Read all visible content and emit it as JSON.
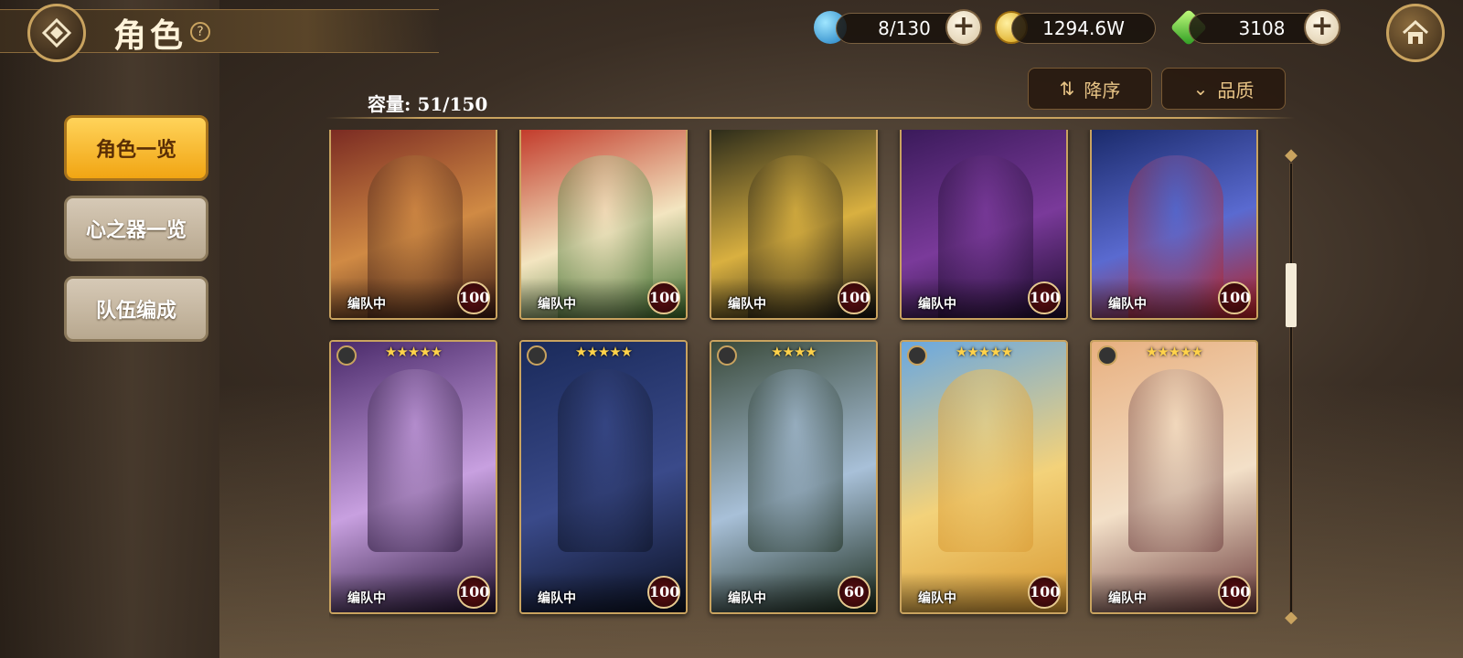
{
  "header": {
    "title": "角色",
    "help": "?",
    "back_icon": "diamond-back-icon",
    "home_icon": "home-icon"
  },
  "resources": {
    "stamina": {
      "value": "8/130",
      "icon": "water-drop-icon"
    },
    "gold": {
      "value": "1294.6W",
      "icon": "gold-coin-icon"
    },
    "gems": {
      "value": "3108",
      "icon": "green-crystal-icon"
    },
    "plus_label": "+"
  },
  "menu": {
    "items": [
      {
        "label": "角色一览",
        "active": true
      },
      {
        "label": "心之器一览",
        "active": false
      },
      {
        "label": "队伍编成",
        "active": false
      }
    ]
  },
  "toolbar": {
    "capacity": "容量: 51/150",
    "sort_label": "降序",
    "filter_label": "品质"
  },
  "cards": [
    {
      "team": "编队中",
      "level": "100",
      "stars": "",
      "colors": [
        "#7a2a22",
        "#d08a44",
        "#3a1a14"
      ]
    },
    {
      "team": "编队中",
      "level": "100",
      "stars": "",
      "colors": [
        "#c23a2a",
        "#f3e5c0",
        "#3b6b2a"
      ]
    },
    {
      "team": "编队中",
      "level": "100",
      "stars": "",
      "colors": [
        "#2a2a1a",
        "#d9b040",
        "#101010"
      ]
    },
    {
      "team": "编队中",
      "level": "100",
      "stars": "",
      "colors": [
        "#3a1a5a",
        "#7a3a9a",
        "#1a0a2a"
      ]
    },
    {
      "team": "编队中",
      "level": "100",
      "stars": "",
      "colors": [
        "#1a2a6a",
        "#5a6ad0",
        "#b82020"
      ]
    },
    {
      "team": "编队中",
      "level": "100",
      "stars": "★★★★★",
      "colors": [
        "#4a2a6a",
        "#c8a0e0",
        "#201030"
      ]
    },
    {
      "team": "编队中",
      "level": "100",
      "stars": "★★★★★",
      "colors": [
        "#1a2a5a",
        "#3a4a8a",
        "#0a1020"
      ]
    },
    {
      "team": "编队中",
      "level": "60",
      "stars": "★★★★",
      "colors": [
        "#3a4a3a",
        "#a8c0d8",
        "#1a2a1a"
      ]
    },
    {
      "team": "编队中",
      "level": "100",
      "stars": "★★★★★",
      "colors": [
        "#6aa8e0",
        "#f3d27a",
        "#d89830"
      ]
    },
    {
      "team": "编队中",
      "level": "100",
      "stars": "★★★★★",
      "colors": [
        "#e8b080",
        "#f3e0c8",
        "#6a3a3a"
      ]
    }
  ]
}
